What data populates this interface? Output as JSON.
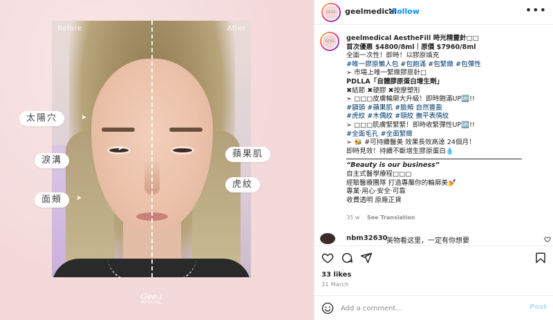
{
  "post": {
    "image": {
      "before_label": "Before",
      "after_label": "After",
      "callouts": {
        "temple": "太陽穴",
        "tear_trough": "淚溝",
        "cheek": "面頰",
        "apple_cheek": "蘋果肌",
        "tiger_line": "虎紋"
      },
      "logo_main": "Gee.l",
      "logo_sub": "MEDICAL",
      "background_color": "#f4d9da"
    },
    "header": {
      "username": "geelmedical",
      "separator": "•",
      "follow_label": "Follow",
      "more_icon": "more-horizontal-icon",
      "avatar_text": "GEEL"
    },
    "caption": {
      "username": "geelmedical",
      "lines": [
        "AestheFill 時光精靈針□□",
        "首次優惠 $4800/8ml｜原價 $7960/8ml",
        "全面一次性！即時！以膠原填充",
        "#唯一膠原懶人包 #包飽滿 #包緊緻 #包彈性",
        "➢ 市場上唯一緊緻膠原針□",
        "PDLLA「自體膠原蛋白增生劑」",
        "✖結節 ✖硬膠 ✖按摩塑形",
        "➢ □□□皮膚輪廓大升級！即時飽滿UP🆙!!",
        "#額頭 #蘋果肌 #臉頰 自然豐盈",
        "#虎紋 #木偶紋 #頸紋 撫平表情紋",
        "➢ □□□肌膚緊緊緊！即時收緊彈性UP🆙!!",
        "#全面毛孔 #全面緊緻",
        "➢ 🐝 #可持續醫美 效果長效高達 24個月！",
        "即時見效！持續不斷增生膠原蛋白💧",
        "“Beauty is our business”",
        "自主式醫學療程□□□",
        "經驗醫療團隊 打造專屬你的輪廓美💅",
        "專業·用心·安全·可靠",
        "收費透明 原廠正貨"
      ]
    },
    "meta": {
      "time_ago": "35 w",
      "translate_label": "See Translation"
    },
    "comment": {
      "username": "nbm32630",
      "text": "美物看这里，一定有你想要"
    },
    "actions": {
      "like_icon": "heart-icon",
      "comment_icon": "comment-icon",
      "share_icon": "share-icon",
      "save_icon": "bookmark-icon"
    },
    "likes_text": "33 likes",
    "date_text": "31 March",
    "add_comment": {
      "placeholder": "Add a comment...",
      "post_label": "Post",
      "emoji_icon": "emoji-icon"
    },
    "colors": {
      "accent": "#0095f6",
      "hashtag": "#00376b",
      "post_disabled": "#b3dbff"
    }
  }
}
